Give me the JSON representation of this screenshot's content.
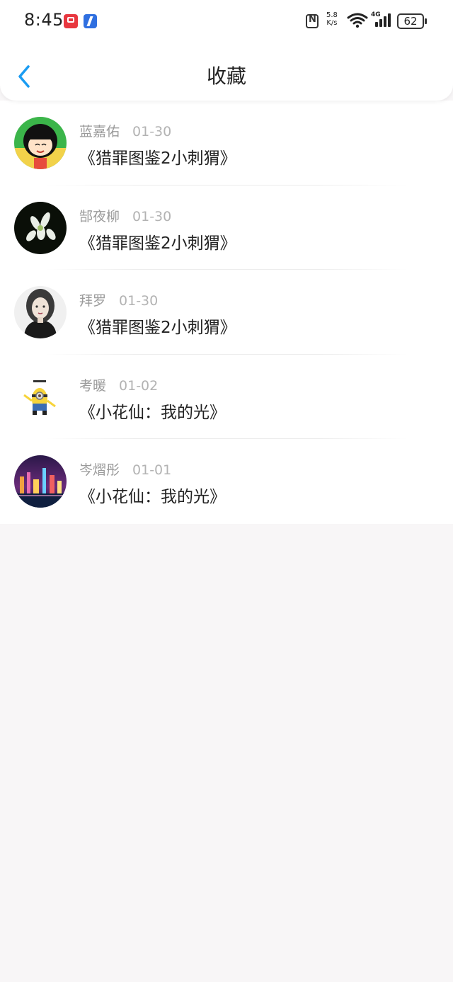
{
  "status_bar": {
    "time": "8:45",
    "net_speed_value": "5.8",
    "net_speed_unit": "K/s",
    "signal_label": "4G",
    "battery": "62"
  },
  "header": {
    "title": "收藏"
  },
  "items": [
    {
      "name": "蓝嘉佑",
      "date": "01-30",
      "book": "《猎罪图鉴2小刺猬》"
    },
    {
      "name": "郜夜柳",
      "date": "01-30",
      "book": "《猎罪图鉴2小刺猬》"
    },
    {
      "name": "拜罗",
      "date": "01-30",
      "book": "《猎罪图鉴2小刺猬》"
    },
    {
      "name": "考暖",
      "date": "01-02",
      "book": "《小花仙：我的光》"
    },
    {
      "name": "岑熠彤",
      "date": "01-01",
      "book": "《小花仙：我的光》"
    }
  ],
  "colors": {
    "accent": "#1a9cf2",
    "background": "#f8f6f7"
  }
}
